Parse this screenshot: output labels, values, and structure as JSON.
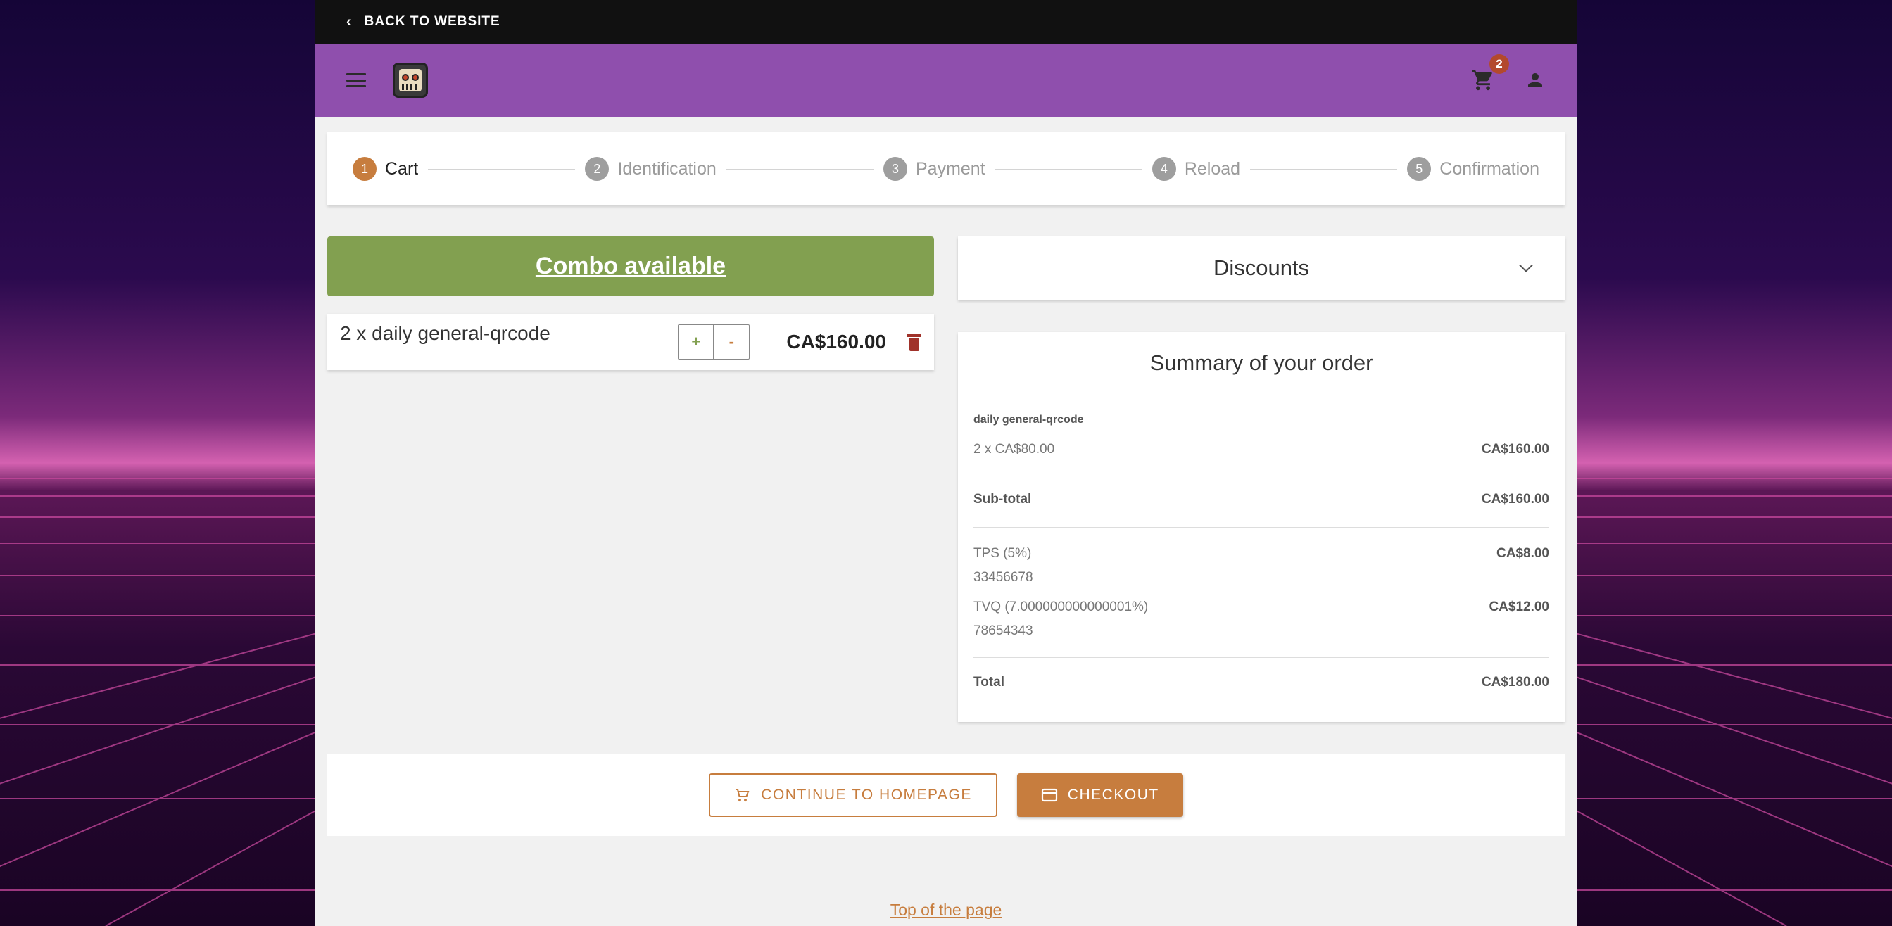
{
  "topbar": {
    "back_label": "BACK TO WEBSITE"
  },
  "header": {
    "cart_count": "2"
  },
  "steps": [
    {
      "num": "1",
      "label": "Cart"
    },
    {
      "num": "2",
      "label": "Identification"
    },
    {
      "num": "3",
      "label": "Payment"
    },
    {
      "num": "4",
      "label": "Reload"
    },
    {
      "num": "5",
      "label": "Confirmation"
    }
  ],
  "combo": {
    "label": "Combo available"
  },
  "cart_item": {
    "name": "2 x daily general-qrcode",
    "plus": "+",
    "minus": "-",
    "price": "CA$160.00"
  },
  "discounts": {
    "label": "Discounts"
  },
  "summary": {
    "title": "Summary of your order",
    "product_name": "daily general-qrcode",
    "product_qty": "2 x CA$80.00",
    "product_total": "CA$160.00",
    "subtotal_label": "Sub-total",
    "subtotal_value": "CA$160.00",
    "tax1_label": "TPS (5%)",
    "tax1_number": "33456678",
    "tax1_value": "CA$8.00",
    "tax2_label": "TVQ (7.000000000000001%)",
    "tax2_number": "78654343",
    "tax2_value": "CA$12.00",
    "total_label": "Total",
    "total_value": "CA$180.00"
  },
  "actions": {
    "continue_label": "CONTINUE TO HOMEPAGE",
    "checkout_label": "CHECKOUT"
  },
  "footer": {
    "top_link": "Top of the page"
  },
  "colors": {
    "header": "#8f4fad",
    "accent": "#c77d3e",
    "combo": "#82a050",
    "delete": "#a0322a"
  },
  "icons": [
    "chevron-left-icon",
    "hamburger-icon",
    "robot-logo-icon",
    "cart-icon",
    "user-icon",
    "chevron-down-icon",
    "trash-icon",
    "credit-card-icon"
  ]
}
